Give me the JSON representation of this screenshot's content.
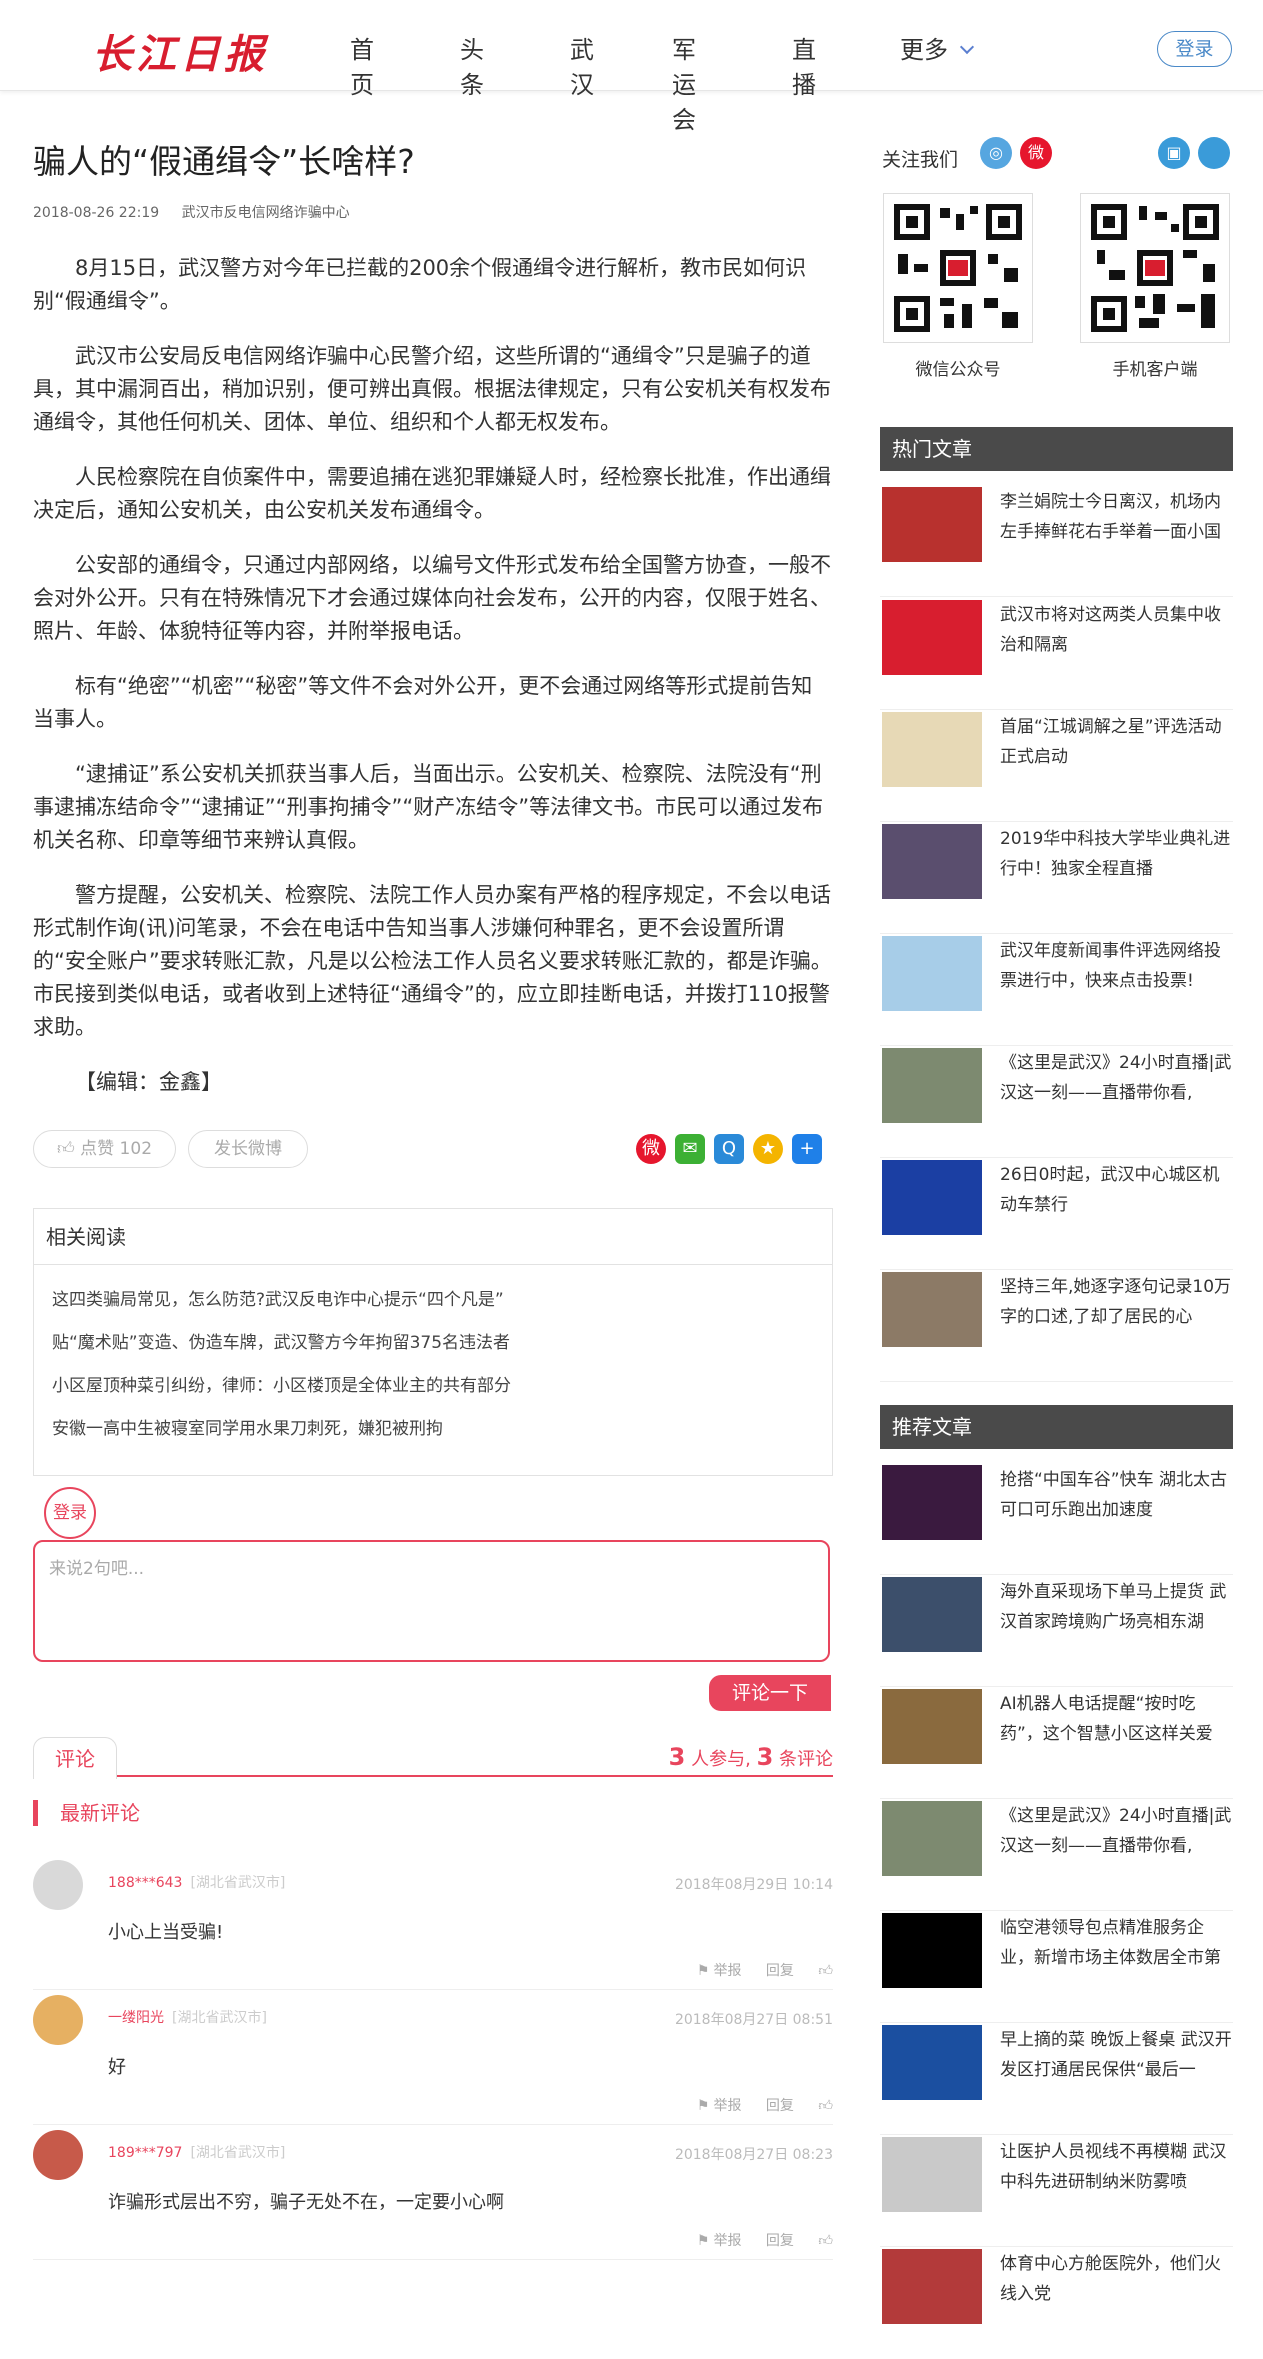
{
  "header": {
    "logo": "长江日报",
    "nav": [
      "首页",
      "头条",
      "武汉",
      "军运会",
      "直播",
      "更多"
    ],
    "login": "登录"
  },
  "article": {
    "title": "骗人的“假通缉令”长啥样?",
    "date": "2018-08-26 22:19",
    "source": "武汉市反电信网络诈骗中心",
    "paragraphs": [
      "8月15日，武汉警方对今年已拦截的200余个假通缉令进行解析，教市民如何识别“假通缉令”。",
      "武汉市公安局反电信网络诈骗中心民警介绍，这些所谓的“通缉令”只是骗子的道具，其中漏洞百出，稍加识别，便可辨出真假。根据法律规定，只有公安机关有权发布通缉令，其他任何机关、团体、单位、组织和个人都无权发布。",
      "人民检察院在自侦案件中，需要追捕在逃犯罪嫌疑人时，经检察长批准，作出通缉决定后，通知公安机关，由公安机关发布通缉令。",
      "公安部的通缉令，只通过内部网络，以编号文件形式发布给全国警方协查，一般不会对外公开。只有在特殊情况下才会通过媒体向社会发布，公开的内容，仅限于姓名、照片、年龄、体貌特征等内容，并附举报电话。",
      "标有“绝密”“机密”“秘密”等文件不会对外公开，更不会通过网络等形式提前告知当事人。",
      "“逮捕证”系公安机关抓获当事人后，当面出示。公安机关、检察院、法院没有“刑事逮捕冻结命令”“逮捕证”“刑事拘捕令”“财产冻结令”等法律文书。市民可以通过发布机关名称、印章等细节来辨认真假。",
      "警方提醒，公安机关、检察院、法院工作人员办案有严格的程序规定，不会以电话形式制作询(讯)问笔录，不会在电话中告知当事人涉嫌何种罪名，更不会设置所谓的“安全账户”要求转账汇款，凡是以公检法工作人员名义要求转账汇款的，都是诈骗。市民接到类似电话，或者收到上述特征“通缉令”的，应立即挂断电话，并拨打110报警求助。"
    ],
    "editor": "【编辑：金鑫】",
    "like": "点赞 102",
    "weibo": "发长微博"
  },
  "related": {
    "heading": "相关阅读",
    "items": [
      "这四类骗局常见，怎么防范?武汉反电诈中心提示“四个凡是”",
      "贴“魔术贴”变造、伪造车牌，武汉警方今年拘留375名违法者",
      "小区屋顶种菜引纠纷，律师：小区楼顶是全体业主的共有部分",
      "安徽一高中生被寝室同学用水果刀刺死，嫌犯被刑拘"
    ]
  },
  "comments": {
    "login": "登录",
    "placeholder": "来说2句吧...",
    "submit": "评论一下",
    "tab": "评论",
    "participants": "3",
    "participants_label": "人参与,",
    "count": "3",
    "count_label": "条评论",
    "latest": "最新评论",
    "report": "举报",
    "reply": "回复",
    "list": [
      {
        "user": "188***643",
        "loc": "[湖北省武汉市]",
        "time": "2018年08月29日 10:14",
        "text": "小心上当受骗!"
      },
      {
        "user": "一缕阳光",
        "loc": "[湖北省武汉市]",
        "time": "2018年08月27日 08:51",
        "text": "好"
      },
      {
        "user": "189***797",
        "loc": "[湖北省武汉市]",
        "time": "2018年08月27日 08:23",
        "text": "诈骗形式层出不穷，骗子无处不在，一定要小心啊"
      }
    ]
  },
  "sidebar": {
    "follow": "关注我们",
    "qr1": "微信公众号",
    "qr2": "手机客户端",
    "hot_heading": "热门文章",
    "hot": [
      "李兰娟院士今日离汉，机场内左手捧鲜花右手举着一面小国",
      "武汉市将对这两类人员集中收治和隔离",
      "首届“江城调解之星”评选活动正式启动",
      "2019华中科技大学毕业典礼进行中！独家全程直播",
      "武汉年度新闻事件评选网络投票进行中，快来点击投票!",
      "《这里是武汉》24小时直播|武汉这一刻——直播带你看,",
      "26日0时起，武汉中心城区机动车禁行",
      "坚持三年,她逐字逐句记录10万字的口述,了却了居民的心"
    ],
    "rec_heading": "推荐文章",
    "rec": [
      "抢搭“中国车谷”快车 湖北太古可口可乐跑出加速度",
      "海外直采现场下单马上提货 武汉首家跨境购广场亮相东湖",
      "AI机器人电话提醒“按时吃药”，这个智慧小区这样关爱",
      "《这里是武汉》24小时直播|武汉这一刻——直播带你看,",
      "临空港领导包点精准服务企业，新增市场主体数居全市第",
      "早上摘的菜 晚饭上餐桌 武汉开发区打通居民保供“最后一",
      "让医护人员视线不再模糊 武汉中科先进研制纳米防雾喷",
      "体育中心方舱医院外，他们火线入党"
    ]
  }
}
